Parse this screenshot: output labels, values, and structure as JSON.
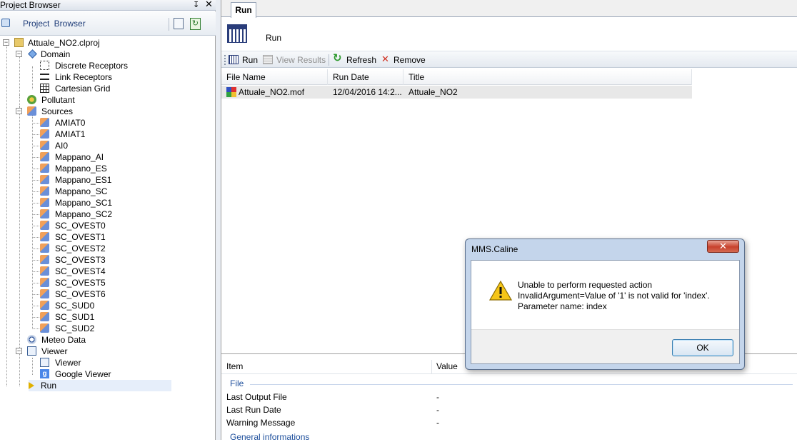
{
  "left_panel": {
    "title": "Project Browser",
    "pin_glyph": "↧",
    "close_glyph": "✕",
    "toolbar_label": "Project Browser",
    "tree": {
      "project": "Attuale_NO2.clproj",
      "domain": "Domain",
      "domain_children": [
        "Discrete Receptors",
        "Link Receptors",
        "Cartesian Grid"
      ],
      "pollutant": "Pollutant",
      "sources": "Sources",
      "source_children": [
        "AMIAT0",
        "AMIAT1",
        "AI0",
        "Mappano_AI",
        "Mappano_ES",
        "Mappano_ES1",
        "Mappano_SC",
        "Mappano_SC1",
        "Mappano_SC2",
        "SC_OVEST0",
        "SC_OVEST1",
        "SC_OVEST2",
        "SC_OVEST3",
        "SC_OVEST4",
        "SC_OVEST5",
        "SC_OVEST6",
        "SC_SUD0",
        "SC_SUD1",
        "SC_SUD2"
      ],
      "meteo": "Meteo Data",
      "viewer": "Viewer",
      "viewer_children": [
        "Viewer",
        "Google Viewer"
      ],
      "run": "Run"
    }
  },
  "run_panel": {
    "tab_label": "Run",
    "header_title": "Run",
    "toolbar": {
      "run": "Run",
      "view_results": "View Results",
      "refresh": "Refresh",
      "remove": "Remove"
    },
    "grid": {
      "columns": [
        "File Name",
        "Run Date",
        "Title"
      ],
      "rows": [
        {
          "file_name": "Attuale_NO2.mof",
          "run_date": "12/04/2016 14:2...",
          "title": "Attuale_NO2"
        }
      ]
    },
    "properties": {
      "columns": [
        "Item",
        "Value"
      ],
      "category_file": "File",
      "rows": [
        {
          "item": "Last Output File",
          "value": "-"
        },
        {
          "item": "Last Run Date",
          "value": "-"
        },
        {
          "item": "Warning Message",
          "value": "-"
        }
      ],
      "category_general": "General informations"
    }
  },
  "dialog": {
    "title": "MMS.Caline",
    "close_glyph": "✕",
    "message_line1": "Unable to perform requested action",
    "message_line2": "InvalidArgument=Value of '1' is not valid for 'index'.",
    "message_line3": "Parameter name: index",
    "ok_label": "OK"
  }
}
